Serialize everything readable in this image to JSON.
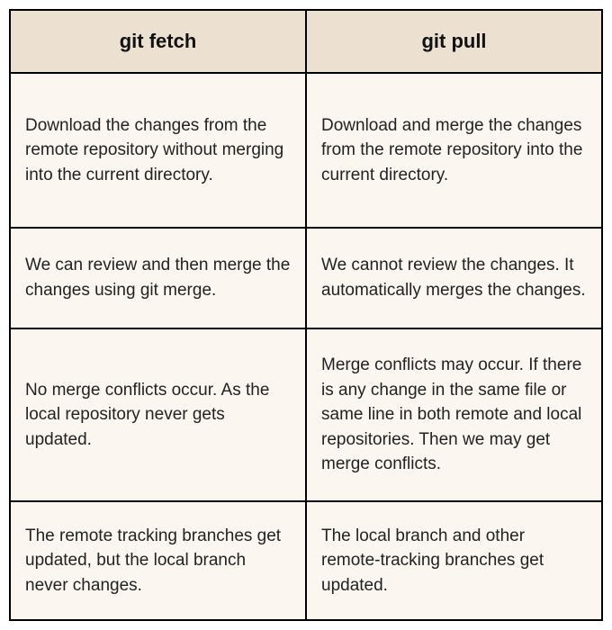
{
  "table": {
    "headers": [
      "git fetch",
      "git pull"
    ],
    "rows": [
      {
        "fetch": "Download the changes from the remote repository without merging into the current directory.",
        "pull": "Download and merge the changes from the remote repository into the current directory."
      },
      {
        "fetch": "We can review and then merge the changes using git merge.",
        "pull": "We cannot review the changes. It automatically merges the changes."
      },
      {
        "fetch": "No merge conflicts occur. As the local repository never gets updated.",
        "pull": "Merge conflicts may occur. If there is any change in the same file or same line in both remote and local repositories. Then we may get merge conflicts."
      },
      {
        "fetch": "The remote tracking branches get updated, but the local branch never changes.",
        "pull": "The local branch and other remote-tracking branches get updated."
      }
    ]
  }
}
